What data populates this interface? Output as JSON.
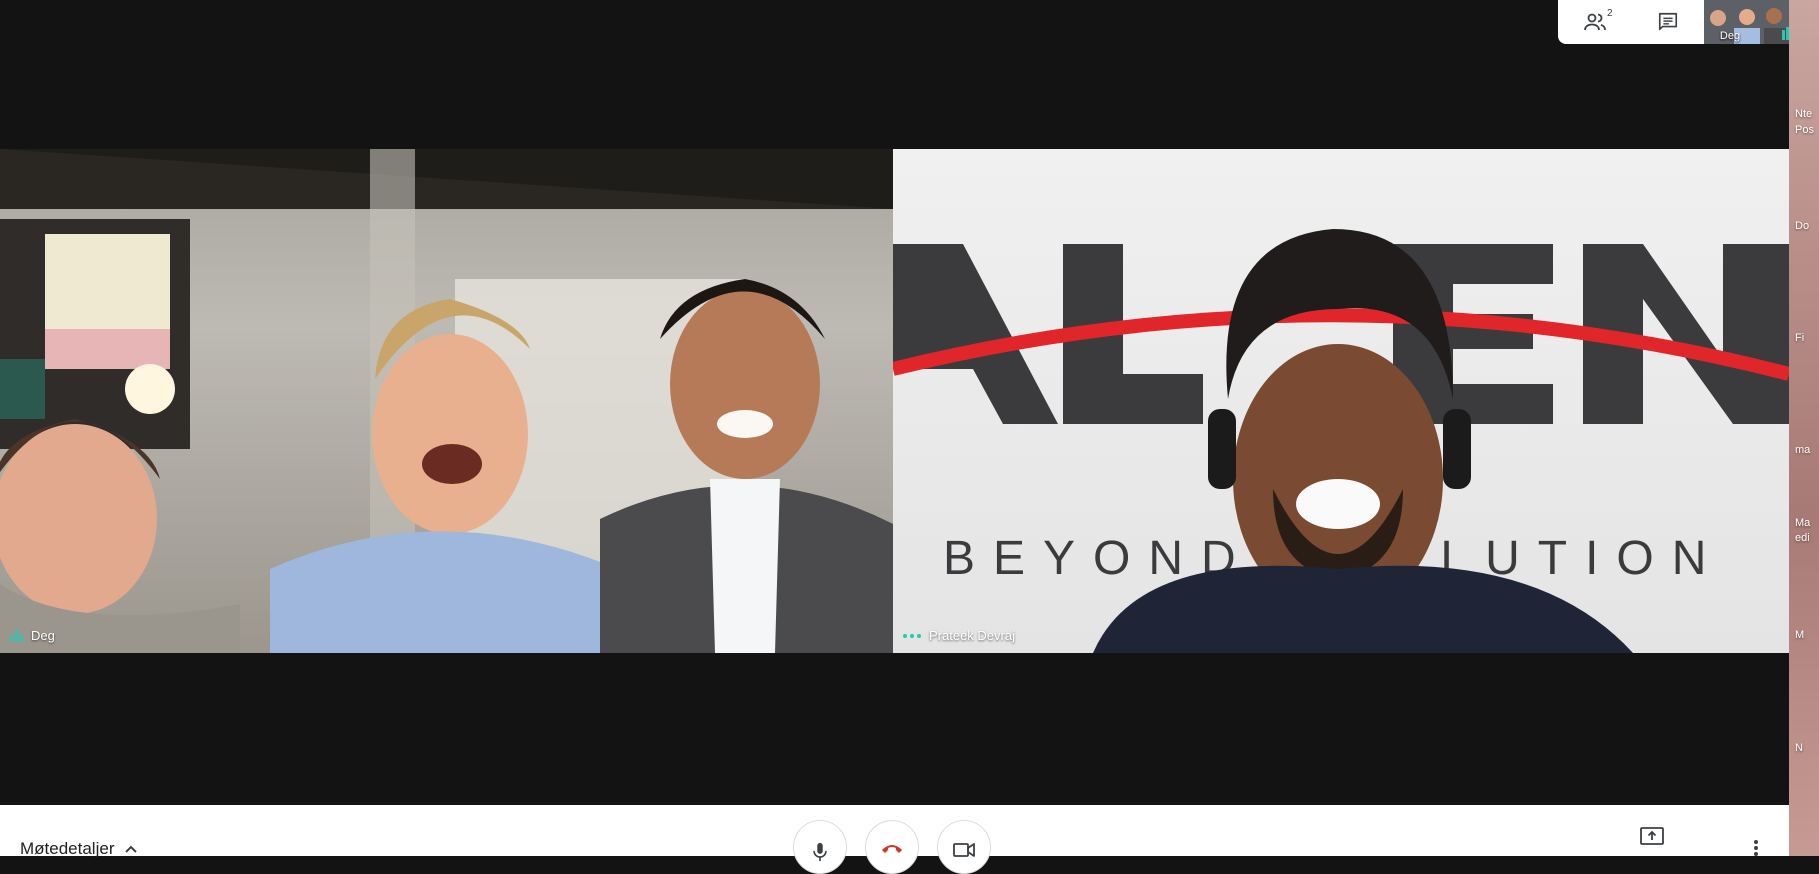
{
  "participants": {
    "you": {
      "name": "Deg"
    },
    "remote": {
      "name": "Prateek Devraj",
      "background_top_text": "ALTEN",
      "background_tagline": "BEYOND EVOLUTION"
    }
  },
  "top_panel": {
    "people_count": "2",
    "thumbnail_name": "Deg"
  },
  "bottom_bar": {
    "meeting_details_label": "Møtedetaljer"
  },
  "desktop_strip": [
    "Nte",
    "Pos",
    "Do",
    "Fi",
    "ma",
    "Ma",
    "edi",
    "M",
    "N"
  ],
  "colors": {
    "accent": "#28c7b2",
    "hangup": "#d93025",
    "stage": "#131313",
    "brand_red": "#e0262a"
  },
  "icons": {
    "people": "people-icon",
    "chat": "chat-icon",
    "mic": "mic-icon",
    "hangup": "hangup-icon",
    "camera": "camera-icon",
    "present": "present-icon",
    "more": "more-vert-icon",
    "chevron": "chevron-up-icon"
  }
}
